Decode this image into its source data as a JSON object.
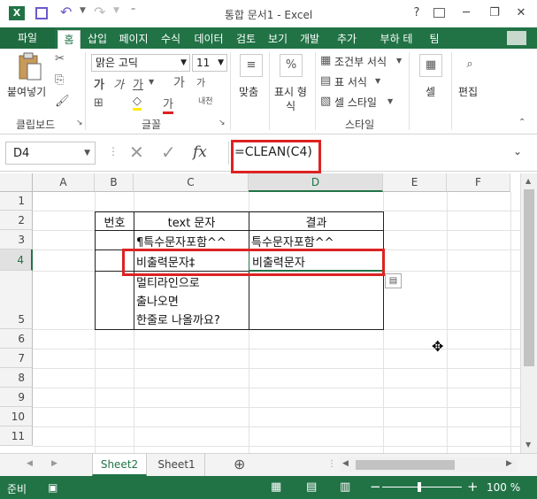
{
  "title": "통합 문서1 - Excel",
  "titlebar": {
    "help": "?",
    "minimize": "─",
    "restore": "❐",
    "close": "✕"
  },
  "tabs": [
    "파일",
    "홈",
    "삽입",
    "페이지",
    "수식",
    "데이터",
    "검토",
    "보기",
    "개발",
    "추가",
    "부하 테",
    "팀"
  ],
  "ribbon": {
    "paste": "붙여넣기",
    "font_name": "맑은 고딕",
    "font_size": "11",
    "bold": "가",
    "italic": "가",
    "underline": "가",
    "grow": "가",
    "shrink": "가",
    "font_color": "가",
    "phonetic": "내천",
    "align": "맞춤",
    "number_line1": "표시 형",
    "number_line2": "식",
    "percent": "%",
    "cond_format": "조건부 서식",
    "table_format": "표 서식",
    "cell_style": "셀 스타일",
    "cells": "셀",
    "editing": "편집",
    "groups": {
      "clipboard": "클립보드",
      "font": "글꼴",
      "style": "스타일"
    }
  },
  "formula_bar": {
    "name_box": "D4",
    "formula": "=CLEAN(C4)",
    "fx": "fx"
  },
  "columns": [
    "A",
    "B",
    "C",
    "D",
    "E",
    "F"
  ],
  "rows": [
    "1",
    "2",
    "3",
    "4",
    "5",
    "6",
    "7",
    "8",
    "9",
    "10",
    "11"
  ],
  "cells": {
    "B2": "번호",
    "C2": "text 문자",
    "D2": "결과",
    "C3": "¶특수문자포함^^",
    "D3": "특수문자포함^^",
    "C4": "비출력문자‡",
    "D4": "비출력문자",
    "C5_line1": "멀티라인으로",
    "C5_line2": "출나오면",
    "C5_line3": "한줄로 나올까요?"
  },
  "sheets": [
    "Sheet2",
    "Sheet1"
  ],
  "add_sheet": "⊕",
  "status": {
    "ready": "준비",
    "zoom": "100 %"
  },
  "colors": {
    "accent": "#217346",
    "highlight": "#d22"
  }
}
